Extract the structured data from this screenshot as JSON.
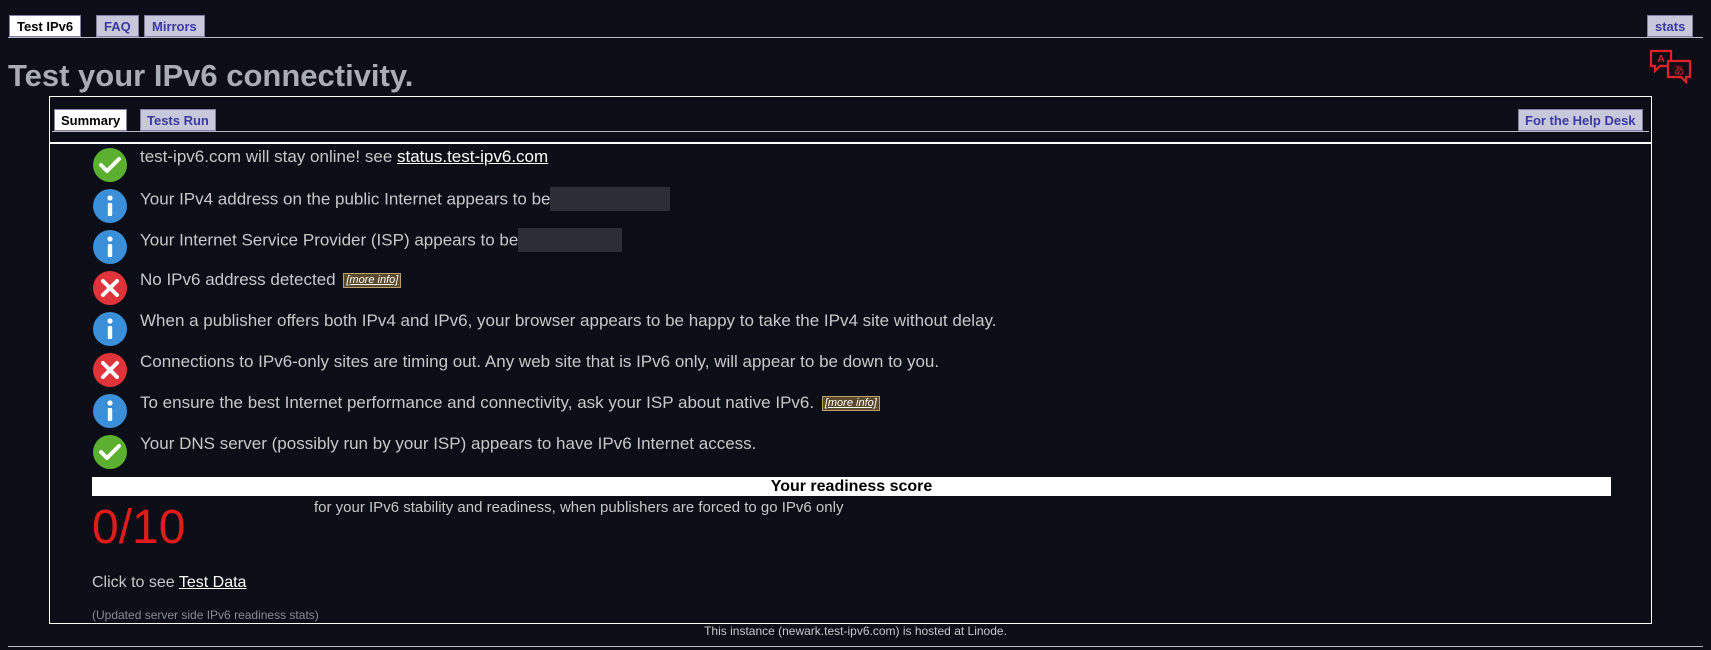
{
  "nav": {
    "tabs": [
      {
        "label": "Test IPv6",
        "active": true
      },
      {
        "label": "FAQ",
        "active": false
      },
      {
        "label": "Mirrors",
        "active": false
      }
    ],
    "stats_label": "stats"
  },
  "translate_icon": "translate-icon",
  "page_title": "Test your IPv6 connectivity.",
  "subnav": {
    "summary_label": "Summary",
    "tests_run_label": "Tests Run",
    "help_desk_label": "For the Help Desk"
  },
  "results": [
    {
      "status": "ok",
      "icon": "check-icon",
      "text": "test-ipv6.com will stay online! see ",
      "link": "status.test-ipv6.com"
    },
    {
      "status": "info",
      "icon": "info-icon",
      "text": "Your IPv4 address on the public Internet appears to be",
      "redacted": true
    },
    {
      "status": "info",
      "icon": "info-icon",
      "text": "Your Internet Service Provider (ISP) appears to be",
      "redacted": true
    },
    {
      "status": "error",
      "icon": "x-icon",
      "text": "No IPv6 address detected ",
      "more": "[more info]"
    },
    {
      "status": "info",
      "icon": "info-icon",
      "text": "When a publisher offers both IPv4 and IPv6, your browser appears to be happy to take the IPv4 site without delay."
    },
    {
      "status": "error",
      "icon": "x-icon",
      "text": "Connections to IPv6-only sites are timing out. Any web site that is IPv6 only, will appear to be down to you."
    },
    {
      "status": "info",
      "icon": "info-icon",
      "text": "To ensure the best Internet performance and connectivity, ask your ISP about native IPv6. ",
      "more": "[more info]"
    },
    {
      "status": "ok",
      "icon": "check-icon",
      "text": "Your DNS server (possibly run by your ISP) appears to have IPv6 Internet access."
    }
  ],
  "score": {
    "heading": "Your readiness score",
    "value": "0/10",
    "description": "for your IPv6 stability and readiness, when publishers are forced to go IPv6 only"
  },
  "test_data": {
    "prefix": "Click to see ",
    "link": "Test Data"
  },
  "updated_note": "(Updated server side IPv6 readiness stats)",
  "footer": "This instance (newark.test-ipv6.com) is hosted at Linode.",
  "colors": {
    "ok": "#5cb030",
    "info": "#3a8fd8",
    "error": "#e0333a",
    "score": "#e11a1a",
    "background": "#0b0e17"
  }
}
